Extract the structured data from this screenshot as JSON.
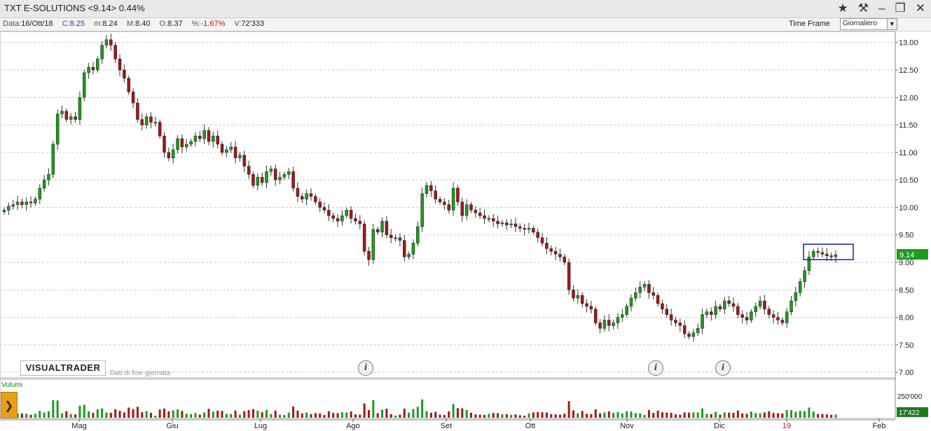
{
  "window": {
    "title": "TXT E-SOLUTIONS <9.14> 0.44%",
    "icons": [
      "star-icon",
      "pin-icon",
      "minimize-icon",
      "maximize-icon",
      "close-icon"
    ]
  },
  "infobar": {
    "data_label": "Data:",
    "data_value": "16/Ott/18",
    "c_label": "C:",
    "c_value": "8.25",
    "m_label": "m:",
    "m_value": "8.24",
    "M_label": "M:",
    "M_value": "8.40",
    "o_label": "O:",
    "o_value": "8.37",
    "pct_label": "%:",
    "pct_value": "-1.67%",
    "v_label": "V:",
    "v_value": "72'333",
    "timeframe_label": "Time Frame",
    "timeframe_value": "Giornaliero"
  },
  "branding": {
    "logo": "VISUALTRADER",
    "eod_note": "Dati di fine giornata"
  },
  "colors": {
    "up": "#1e9a1e",
    "down": "#a01818",
    "grid": "#c8c8c8",
    "last_price_bg": "#1e9a1e",
    "highlight_box": "#1a1ab5"
  },
  "chart_data": {
    "type": "candlestick",
    "ylim": [
      6.9,
      13.2
    ],
    "y_ticks": [
      "13.00",
      "12.50",
      "12.00",
      "11.50",
      "11.00",
      "10.50",
      "10.00",
      "9.50",
      "9.00",
      "8.50",
      "8.00",
      "7.50",
      "7.00"
    ],
    "x_tick_labels": [
      "Mag",
      "Giu",
      "Lug",
      "Ago",
      "Set",
      "Ott",
      "Nov",
      "Dic",
      "19",
      "Feb"
    ],
    "last_price_label": "9.14",
    "close_series": [
      9.95,
      10.02,
      10.05,
      10.1,
      10.05,
      10.1,
      10.08,
      10.15,
      10.35,
      10.5,
      10.6,
      11.15,
      11.7,
      11.75,
      11.6,
      11.65,
      11.6,
      12.0,
      12.45,
      12.55,
      12.5,
      12.7,
      12.95,
      13.05,
      12.95,
      12.7,
      12.5,
      12.35,
      12.1,
      11.9,
      11.6,
      11.5,
      11.65,
      11.55,
      11.55,
      11.3,
      11.0,
      10.9,
      11.05,
      11.25,
      11.1,
      11.15,
      11.2,
      11.3,
      11.25,
      11.4,
      11.2,
      11.3,
      11.15,
      11.0,
      11.05,
      11.1,
      10.9,
      10.95,
      10.75,
      10.6,
      10.4,
      10.55,
      10.45,
      10.65,
      10.7,
      10.5,
      10.55,
      10.6,
      10.65,
      10.35,
      10.2,
      10.15,
      10.25,
      10.2,
      10.1,
      10.0,
      9.95,
      9.85,
      9.8,
      9.75,
      9.85,
      9.95,
      9.8,
      9.75,
      9.7,
      9.2,
      9.05,
      9.6,
      9.55,
      9.75,
      9.5,
      9.45,
      9.45,
      9.4,
      9.1,
      9.15,
      9.35,
      9.65,
      10.25,
      10.4,
      10.3,
      10.15,
      10.1,
      10.05,
      9.95,
      10.35,
      10.1,
      9.85,
      10.05,
      9.95,
      9.9,
      9.85,
      9.8,
      9.8,
      9.75,
      9.7,
      9.72,
      9.68,
      9.7,
      9.65,
      9.62,
      9.6,
      9.62,
      9.55,
      9.45,
      9.35,
      9.25,
      9.2,
      9.15,
      9.1,
      9.0,
      8.5,
      8.35,
      8.4,
      8.25,
      8.2,
      8.15,
      7.9,
      7.8,
      7.95,
      7.85,
      7.9,
      8.0,
      8.05,
      8.2,
      8.35,
      8.45,
      8.55,
      8.6,
      8.45,
      8.4,
      8.25,
      8.15,
      8.05,
      7.95,
      7.9,
      7.85,
      7.7,
      7.65,
      7.72,
      7.8,
      8.05,
      8.1,
      8.05,
      8.2,
      8.15,
      8.3,
      8.25,
      8.2,
      8.05,
      8.0,
      7.95,
      8.1,
      8.2,
      8.3,
      8.15,
      8.05,
      8.0,
      7.95,
      7.9,
      8.1,
      8.3,
      8.45,
      8.65,
      8.85,
      9.1,
      9.2,
      9.18,
      9.15,
      9.12,
      9.1,
      9.14
    ],
    "volume_ylim": [
      0,
      400000
    ],
    "volume_tick_label": "250'000",
    "last_volume_label": "17'422"
  }
}
